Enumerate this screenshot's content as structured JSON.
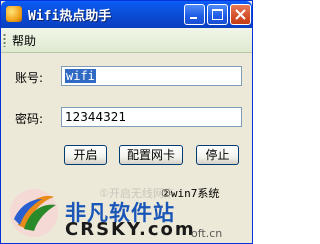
{
  "window": {
    "title": "Wifi热点助手",
    "icon": "app-icon",
    "controls": {
      "minimize": "minimize-icon",
      "maximize": "maximize-icon",
      "close": "close-icon"
    }
  },
  "menu": {
    "help_label": "帮助"
  },
  "form": {
    "account_label": "账号:",
    "account_value": "wifi",
    "password_label": "密码:",
    "password_value": "12344321"
  },
  "buttons": {
    "start_label": "开启",
    "config_label": "配置网卡",
    "stop_label": "停止"
  },
  "tips": {
    "tip1": "①开启无线网卡",
    "tip2": "②win7系统",
    "tip3": "oft.cn"
  },
  "watermark": {
    "title": "非凡软件站",
    "subtitle": "CRSKY.com"
  },
  "colors": {
    "titlebar": "#0a4ed8",
    "menubar": "#e6efd9",
    "selection": "#316ac5",
    "window_bg": "#ece9d8"
  }
}
